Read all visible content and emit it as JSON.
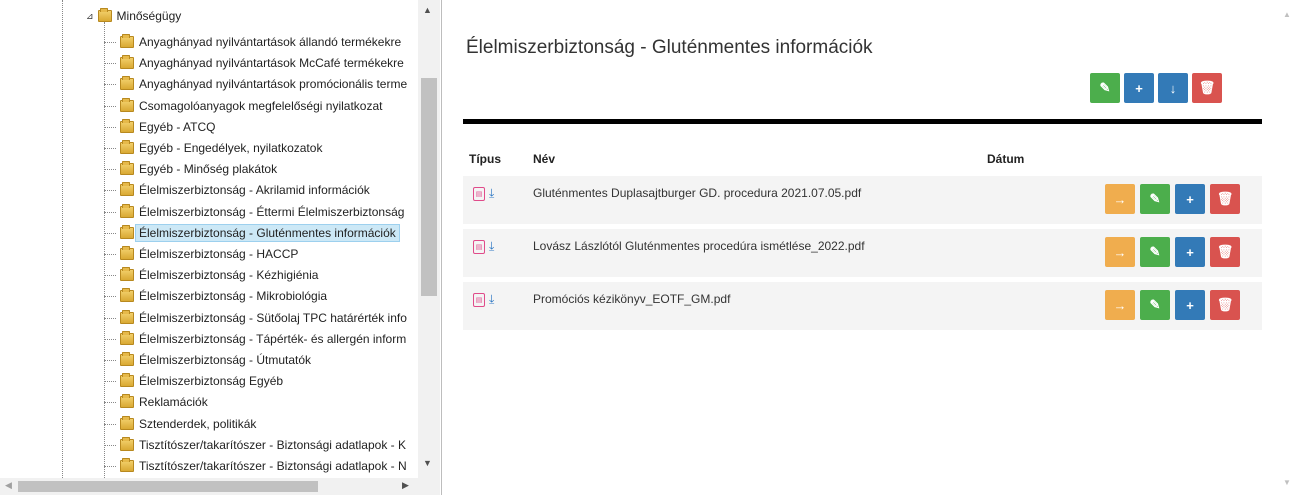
{
  "tree": {
    "parent": {
      "label": "Minőségügy",
      "expander": "⊿"
    },
    "items": [
      {
        "label": "Anyaghányad nyilvántartások állandó termékekre"
      },
      {
        "label": "Anyaghányad nyilvántartások McCafé termékekre"
      },
      {
        "label": "Anyaghányad nyilvántartások promócionális terme"
      },
      {
        "label": "Csomagolóanyagok megfelelőségi nyilatkozat"
      },
      {
        "label": "Egyéb - ATCQ"
      },
      {
        "label": "Egyéb - Engedélyek, nyilatkozatok"
      },
      {
        "label": "Egyéb - Minőség plakátok"
      },
      {
        "label": "Élelmiszerbiztonság - Akrilamid információk"
      },
      {
        "label": "Élelmiszerbiztonság - Éttermi Élelmiszerbiztonság"
      },
      {
        "label": "Élelmiszerbiztonság - Gluténmentes információk",
        "selected": true
      },
      {
        "label": "Élelmiszerbiztonság - HACCP"
      },
      {
        "label": "Élelmiszerbiztonság - Kézhigiénia"
      },
      {
        "label": "Élelmiszerbiztonság - Mikrobiológia"
      },
      {
        "label": "Élelmiszerbiztonság - Sütőolaj TPC határérték info"
      },
      {
        "label": "Élelmiszerbiztonság - Tápérték- és allergén inform"
      },
      {
        "label": "Élelmiszerbiztonság - Útmutatók"
      },
      {
        "label": "Élelmiszerbiztonság Egyéb"
      },
      {
        "label": "Reklamációk"
      },
      {
        "label": "Sztenderdek, politikák"
      },
      {
        "label": "Tisztítószer/takarítószer - Biztonsági adatlapok - K"
      },
      {
        "label": "Tisztítószer/takarítószer - Biztonsági adatlapok - N"
      }
    ]
  },
  "main": {
    "title": "Élelmiszerbiztonság - Gluténmentes információk",
    "header_actions": [
      {
        "name": "edit-folder-button",
        "icon": "pencil-icon",
        "glyph": "✎",
        "color": "green"
      },
      {
        "name": "add-button",
        "icon": "plus-icon",
        "glyph": "+",
        "color": "blue"
      },
      {
        "name": "download-button",
        "icon": "arrow-down-icon",
        "glyph": "↓",
        "color": "blue"
      },
      {
        "name": "delete-folder-button",
        "icon": "trash-icon",
        "glyph": "🗑",
        "color": "red"
      }
    ],
    "columns": {
      "type": "Típus",
      "name": "Név",
      "date": "Dátum"
    },
    "files": [
      {
        "name": "Gluténmentes Duplasajtburger GD. procedura 2021.07.05.pdf",
        "date": ""
      },
      {
        "name": "Lovász Lászlótól Gluténmentes procedúra ismétlése_2022.pdf",
        "date": ""
      },
      {
        "name": "Promóciós kézikönyv_EOTF_GM.pdf",
        "date": ""
      }
    ],
    "row_action_glyphs": {
      "move": "→",
      "edit": "✎",
      "add": "+",
      "delete": "🗑"
    },
    "file_type_label": "PDF"
  },
  "colors": {
    "green": "#4cae4c",
    "blue": "#337ab7",
    "red": "#d9534f",
    "orange": "#f0ad4e",
    "selected_bg": "#cce8f6"
  }
}
